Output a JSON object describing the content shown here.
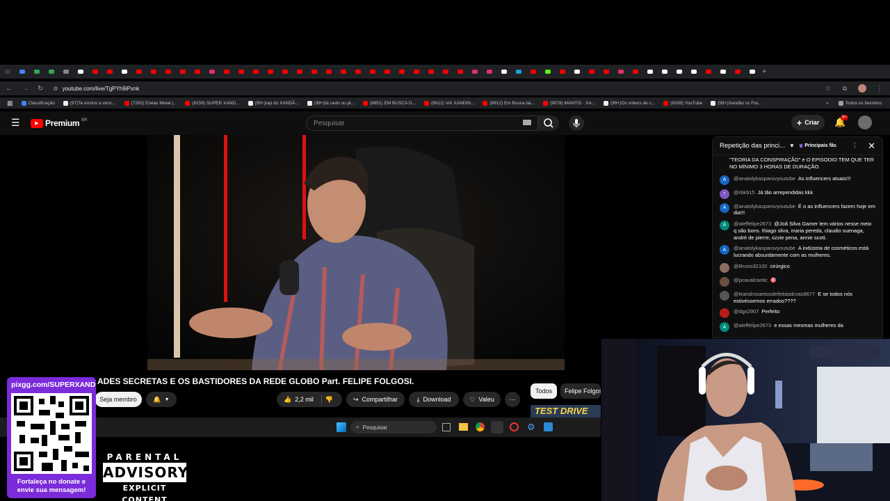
{
  "browser": {
    "url": "youtube.com/live/TgPYh9iPxnk",
    "bookmarks": [
      {
        "label": "Classificação",
        "color": "#4285f4"
      },
      {
        "label": "(97)Te ensino a venc...",
        "color": "#eee"
      },
      {
        "label": "(7292) Enéas Metal |...",
        "color": "#ff0000"
      },
      {
        "label": "(8159) SUPER XAND...",
        "color": "#ff0000"
      },
      {
        "label": "(99+)rap do XANDÃ...",
        "color": "#eee"
      },
      {
        "label": "(99+)tá cedo ou já...",
        "color": "#eee"
      },
      {
        "label": "(8851) EM BUSCA D...",
        "color": "#ff0000"
      },
      {
        "label": "(8912) VAI XANDIN...",
        "color": "#ff0000"
      },
      {
        "label": "(8912) Em Busca da...",
        "color": "#ff0000"
      },
      {
        "label": "(9078) MANTIS · XA...",
        "color": "#ff0000"
      },
      {
        "label": "(99+)Os vídeos de c...",
        "color": "#eee"
      },
      {
        "label": "(9338) YouTube",
        "color": "#ff0000"
      },
      {
        "label": "(99+)Xandão vs Fra...",
        "color": "#eee"
      }
    ],
    "all_favorites": "Todos os favoritos"
  },
  "youtube": {
    "logo": "Premium",
    "region": "BR",
    "search_placeholder": "Pesquisar",
    "create": "Criar",
    "notif_count": "9+"
  },
  "video": {
    "title": "ADES SECRETAS E OS BASTIDORES DA REDE GLOBO Part. FELIPE FOLGOSI.",
    "member_button": "Seja membro",
    "likes": "2,2 mil",
    "share": "Compartilhar",
    "download": "Download",
    "thanks": "Valeu",
    "chip_all": "Todos",
    "chip_channel": "Felipe Folgos",
    "thumb_text": "TEST DRIVE"
  },
  "chat": {
    "header": "Repetição das princi...",
    "badge": "Principais fãs",
    "pinned": "\"TEORIA DA CONSPIRAÇÃO\" e O EPISODIO TEM QUE TER NO MÍNIMO 3 HORAS DE DURAÇÃO.",
    "messages": [
      {
        "initial": "A",
        "color": "#1565c0",
        "author": "@anatolykasparovyoutube",
        "text": "As influencers atuais!!!"
      },
      {
        "initial": "r",
        "color": "#7e57c2",
        "author": "@rbk915",
        "text": "Já tão arrependidas kkk"
      },
      {
        "initial": "A",
        "color": "#1565c0",
        "author": "@anatolykasparovyoutube",
        "text": "É o as influencers fazem hoje em dia!!!"
      },
      {
        "initial": "A",
        "color": "#00897b",
        "author": "@aleffelipe2673",
        "text": "@Joã Silva Gamer tem vários nesse meio q são bons. thiago silva, maria pereda, claudio suenaga, andré de pierre, ozzie pena, annie scott."
      },
      {
        "initial": "A",
        "color": "#1565c0",
        "author": "@anatolykasparovyoutube",
        "text": "A indústria de cosméticos está lucrando absurdamente com as mulheres."
      },
      {
        "initial": "",
        "color": "#8d6e63",
        "author": "@Bruno32100",
        "text": "cirúrgico"
      },
      {
        "initial": "",
        "color": "#6d4c41",
        "author": "@pcavalcantic",
        "text": "🎯"
      },
      {
        "initial": "",
        "color": "#555",
        "author": "@leandrosantosdefeitasdcvas8677",
        "text": "E se todos nós estivéssemos errados????"
      },
      {
        "initial": "",
        "color": "#b71c1c",
        "author": "@dgx2907",
        "text": "Perfeito"
      },
      {
        "initial": "A",
        "color": "#00897b",
        "author": "@aleffelipe2673",
        "text": "e essas mesmas mulheres da"
      }
    ]
  },
  "taskbar": {
    "search": "Pesquisar"
  },
  "overlay": {
    "qr_url": "pixgg.com/SUPERXAND",
    "qr_caption": "Fortaleça no donate e envie sua mensagem!",
    "advisory_top": "PARENTAL",
    "advisory_mid": "ADVISORY",
    "advisory_bot": "EXPLICIT CONTENT"
  }
}
